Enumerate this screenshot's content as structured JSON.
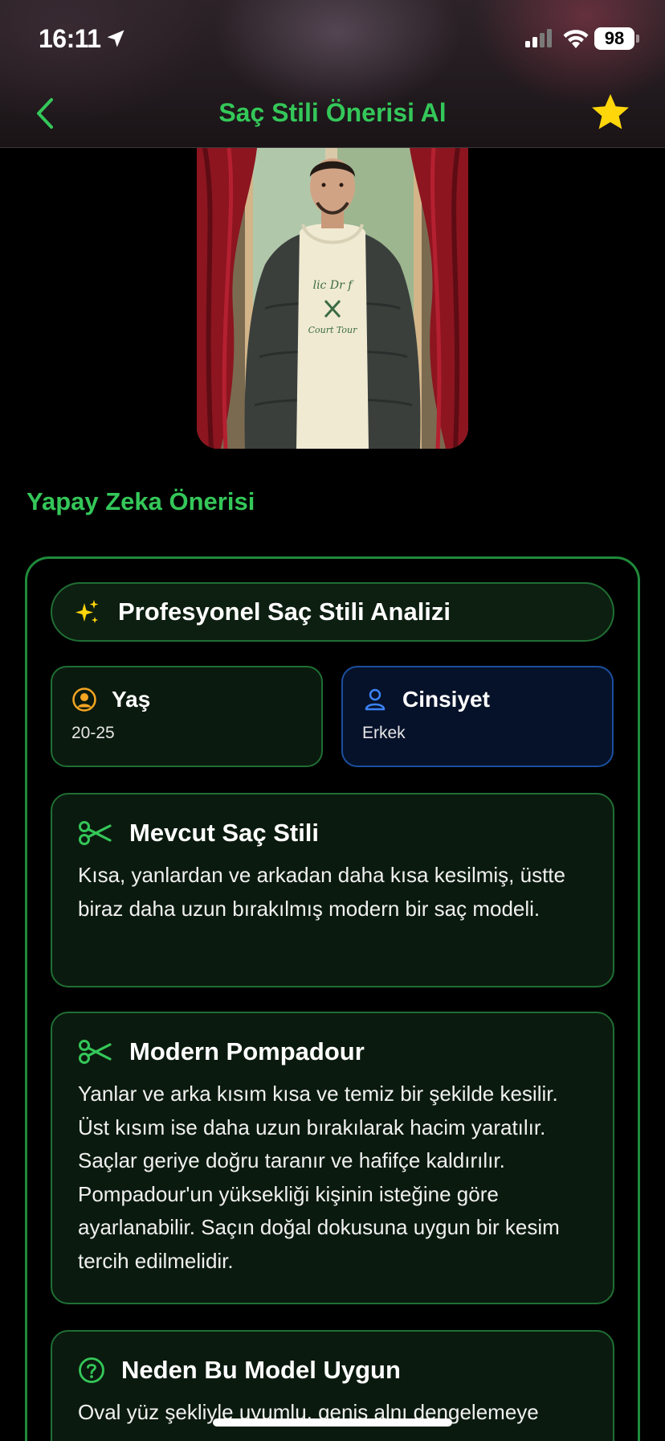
{
  "status_bar": {
    "time": "16:11",
    "battery": "98"
  },
  "nav": {
    "title": "Saç Stili Önerisi Al"
  },
  "photo": {
    "alt": "Kullanıcı fotoğrafı"
  },
  "section_title": "Yapay Zeka Önerisi",
  "analysis": {
    "title": "Profesyonel Saç Stili Analizi"
  },
  "info": {
    "age_label": "Yaş",
    "age_value": "20-25",
    "gender_label": "Cinsiyet",
    "gender_value": "Erkek"
  },
  "cards": [
    {
      "title": "Mevcut Saç Stili",
      "body": "Kısa, yanlardan ve arkadan daha kısa kesilmiş, üstte biraz daha uzun bırakılmış modern bir saç modeli."
    },
    {
      "title": "Modern Pompadour",
      "body": "Yanlar ve arka kısım kısa ve temiz bir şekilde kesilir. Üst kısım ise daha uzun bırakılarak hacim yaratılır. Saçlar geriye doğru taranır ve hafifçe kaldırılır.  Pompadour'un yüksekliği kişinin isteğine göre ayarlanabilir.  Saçın doğal dokusuna uygun bir kesim tercih edilmelidir."
    },
    {
      "title": "Neden Bu Model Uygun",
      "body": "Oval yüz şekliyle uyumlu, geniş alnı dengelemeye"
    }
  ],
  "colors": {
    "accent_green": "#34c759",
    "card_border_green": "#1f6e34",
    "gender_border_blue": "#1c4f9e",
    "star_yellow": "#ffd60a",
    "age_icon_orange": "#f5a623"
  }
}
